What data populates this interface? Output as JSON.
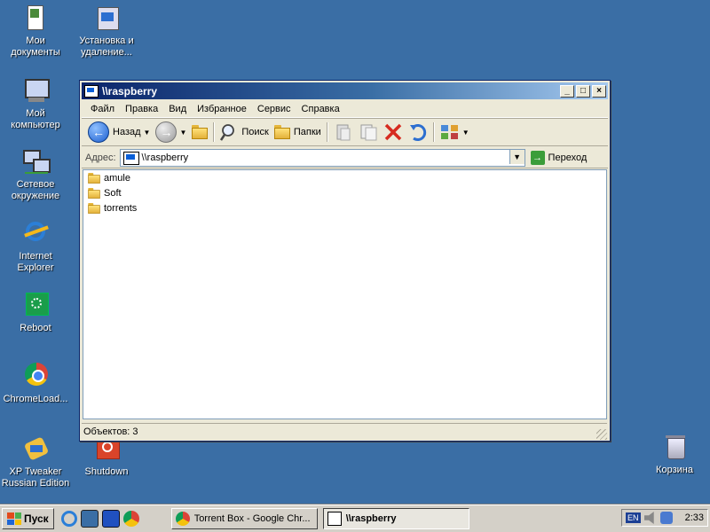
{
  "desktop": {
    "icons": [
      {
        "label": "Мои\nдокументы",
        "icon": "my-documents-icon"
      },
      {
        "label": "Установка и\nудаление...",
        "icon": "add-remove-programs-icon"
      },
      {
        "label": "Мой\nкомпьютер",
        "icon": "my-computer-icon"
      },
      {
        "label": "Сетевое\nокружение",
        "icon": "network-places-icon"
      },
      {
        "label": "Internet\nExplorer",
        "icon": "internet-explorer-icon"
      },
      {
        "label": "Reboot",
        "icon": "reboot-icon"
      },
      {
        "label": "ChromeLoad...",
        "icon": "chrome-icon"
      },
      {
        "label": "XP Tweaker\nRussian Edition",
        "icon": "xp-tweaker-icon"
      },
      {
        "label": "Shutdown",
        "icon": "shutdown-icon"
      },
      {
        "label": "Корзина",
        "icon": "recycle-bin-icon"
      }
    ]
  },
  "window": {
    "title": "\\\\raspberry",
    "menu": [
      "Файл",
      "Правка",
      "Вид",
      "Избранное",
      "Сервис",
      "Справка"
    ],
    "toolbar": {
      "back": "Назад",
      "search": "Поиск",
      "folders": "Папки"
    },
    "address": {
      "label": "Адрес:",
      "value": "\\\\raspberry",
      "go": "Переход"
    },
    "files": [
      "amule",
      "Soft",
      "torrents"
    ],
    "status": "Объектов: 3"
  },
  "taskbar": {
    "start": "Пуск",
    "tasks": [
      {
        "label": "Torrent Box - Google Chr...",
        "active": false
      },
      {
        "label": "\\\\raspberry",
        "active": true
      }
    ],
    "tray": {
      "lang": "EN",
      "time": "2:33"
    }
  },
  "colors": {
    "desktop": "#3a6ea5",
    "titlebar_start": "#0a246a",
    "titlebar_end": "#a6caf0",
    "window_bg": "#ece9d8"
  }
}
